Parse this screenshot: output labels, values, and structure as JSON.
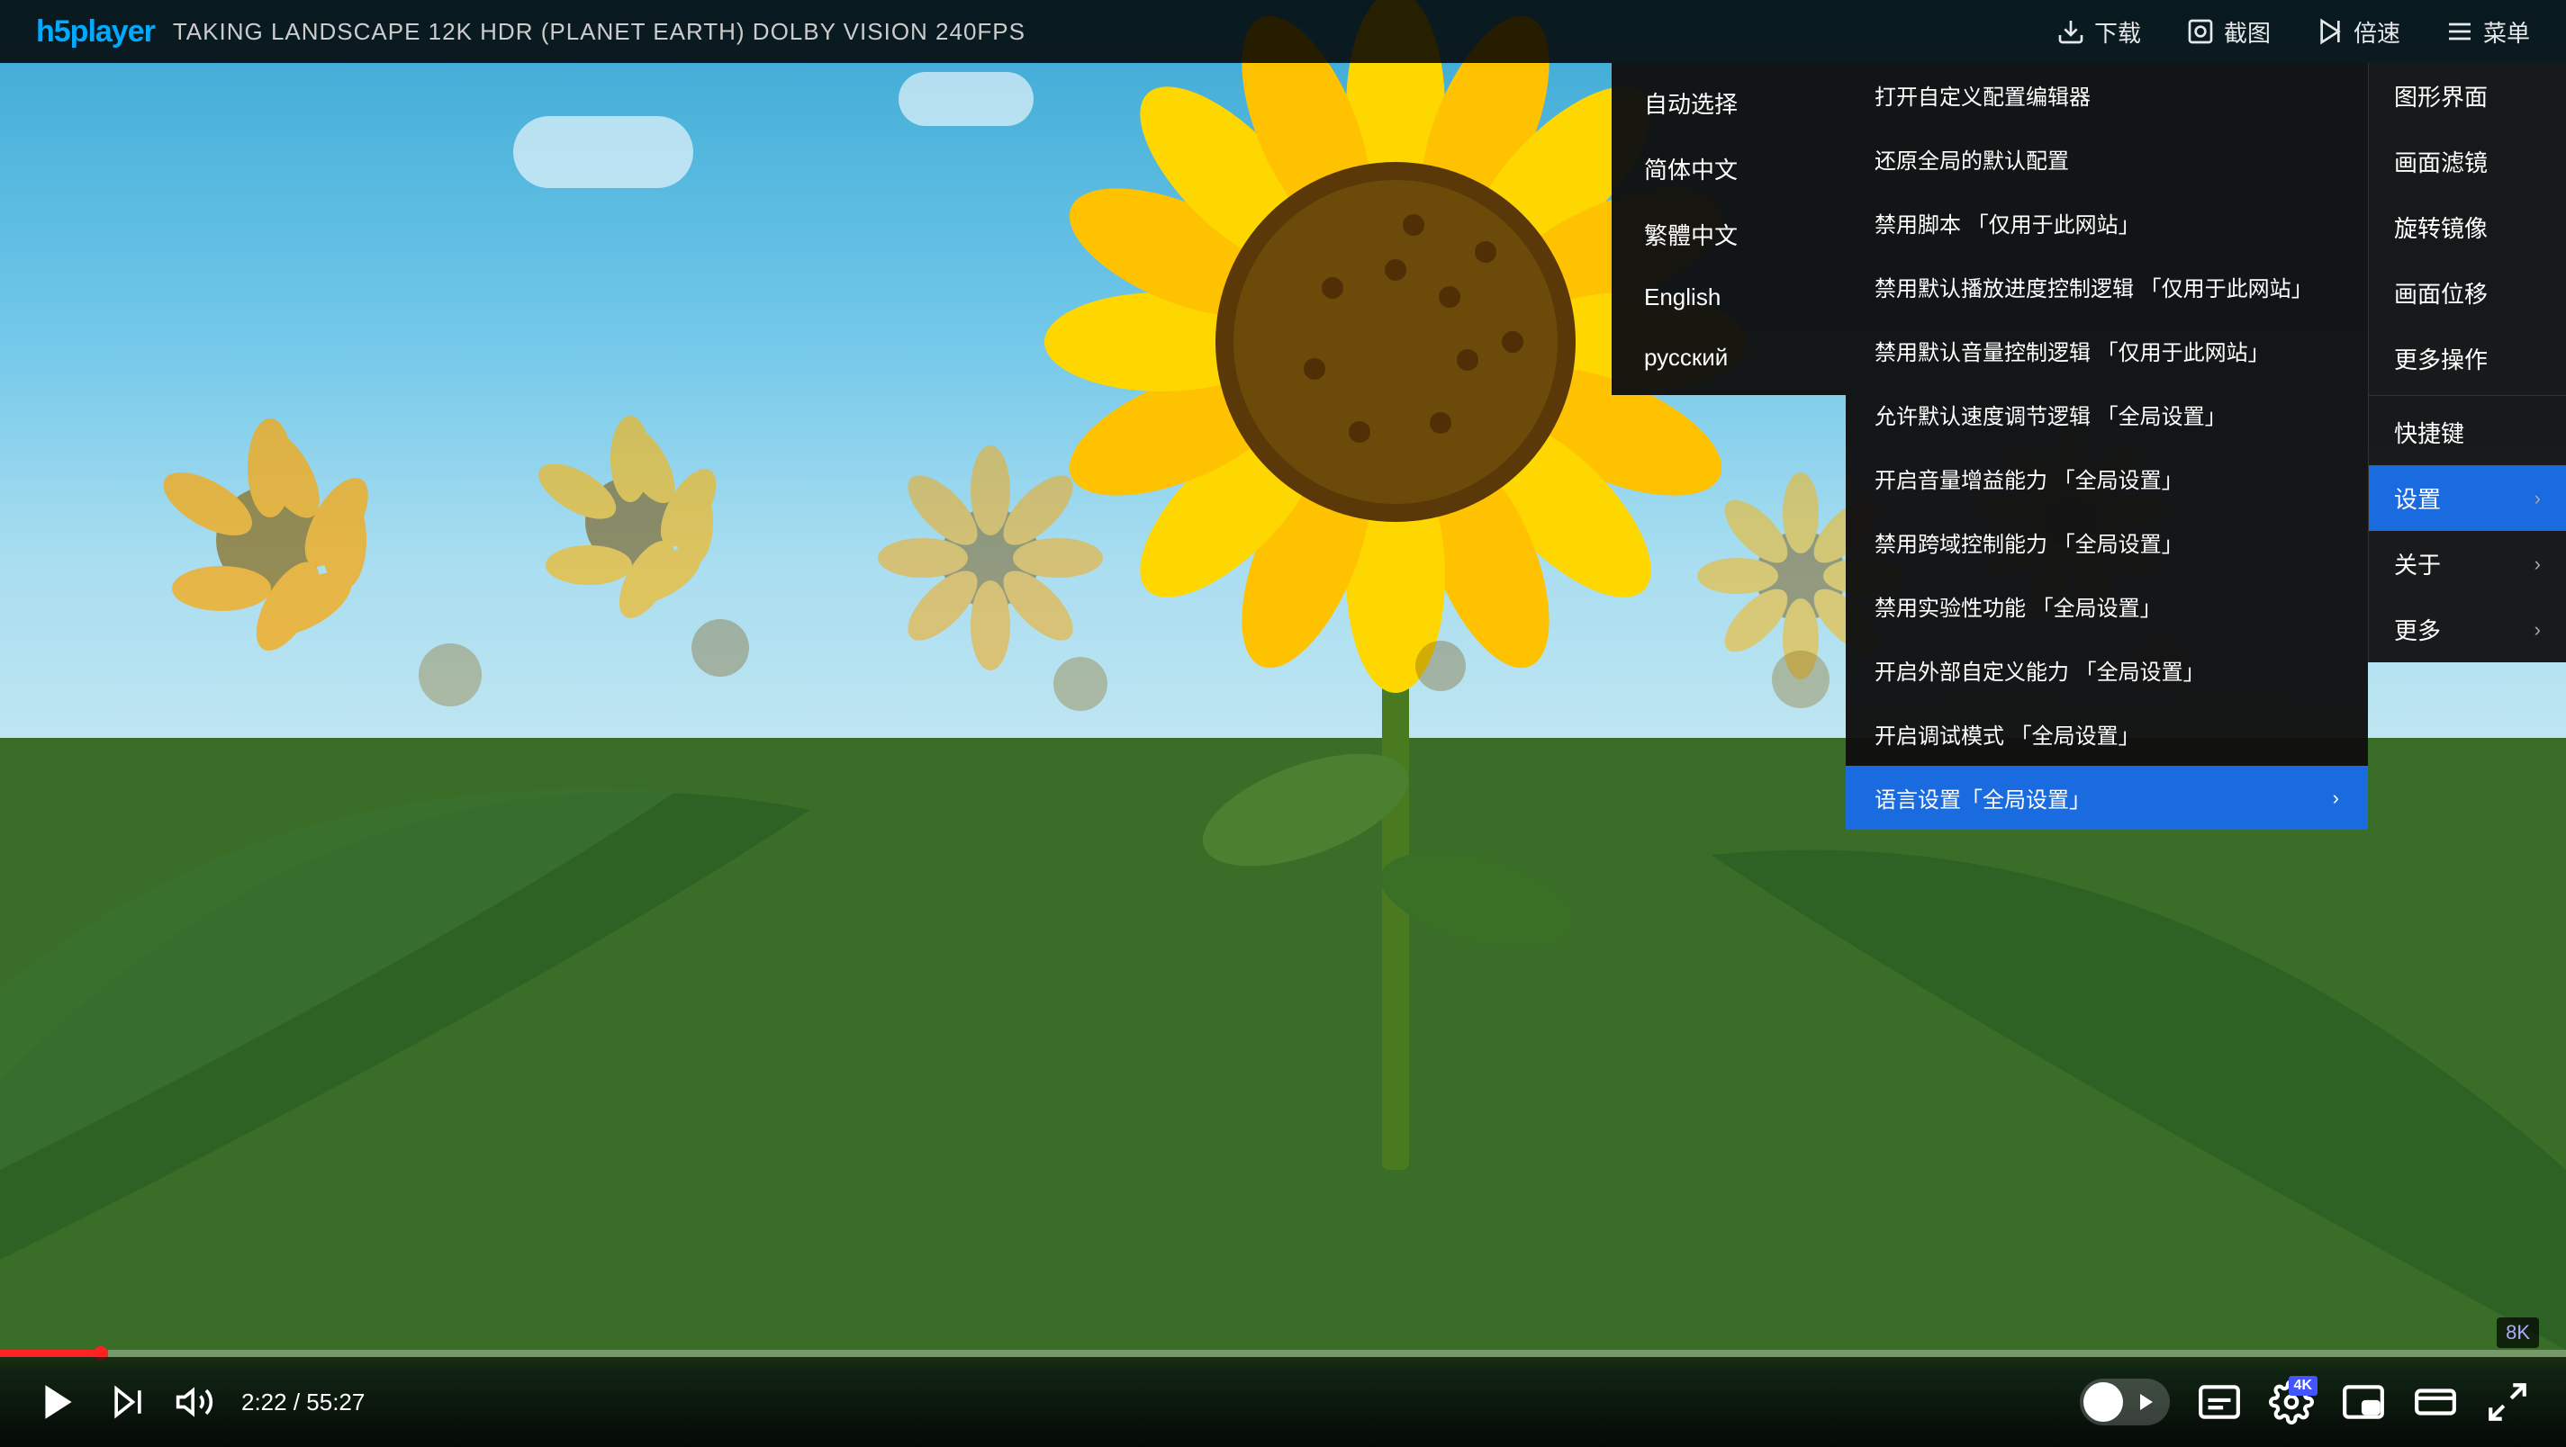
{
  "app": {
    "logo": "h5player",
    "video_title": "TAKING LANDSCAPE 12K HDR (PLANET EARTH) DOLBY VISION  240FPS"
  },
  "topbar": {
    "download_label": "下载",
    "screenshot_label": "截图",
    "speed_label": "倍速",
    "menu_label": "菜单"
  },
  "bottombar": {
    "time_current": "2:22",
    "time_total": "55:27"
  },
  "badge": "8K",
  "main_menu": {
    "items": [
      {
        "label": "图形界面",
        "has_arrow": false
      },
      {
        "label": "画面滤镜",
        "has_arrow": false
      },
      {
        "label": "旋转镜像",
        "has_arrow": false
      },
      {
        "label": "画面位移",
        "has_arrow": false
      },
      {
        "label": "更多操作",
        "has_arrow": false
      },
      {
        "divider": true
      },
      {
        "label": "快捷键",
        "has_arrow": false
      },
      {
        "label": "设置",
        "has_arrow": true,
        "highlighted": true
      },
      {
        "label": "关于",
        "has_arrow": true
      },
      {
        "label": "更多",
        "has_arrow": true
      }
    ]
  },
  "settings_submenu": {
    "items": [
      {
        "label": "打开自定义配置编辑器",
        "has_arrow": false
      },
      {
        "label": "还原全局的默认配置",
        "has_arrow": false
      },
      {
        "label": "禁用脚本 「仅用于此网站」",
        "has_arrow": false
      },
      {
        "label": "禁用默认播放进度控制逻辑 「仅用于此网站」",
        "has_arrow": false
      },
      {
        "label": "禁用默认音量控制逻辑 「仅用于此网站」",
        "has_arrow": false
      },
      {
        "label": "允许默认速度调节逻辑 「全局设置」",
        "has_arrow": false
      },
      {
        "label": "开启音量增益能力 「全局设置」",
        "has_arrow": false
      },
      {
        "label": "禁用跨域控制能力 「全局设置」",
        "has_arrow": false
      },
      {
        "label": "禁用实验性功能 「全局设置」",
        "has_arrow": false
      },
      {
        "label": "开启外部自定义能力 「全局设置」",
        "has_arrow": false
      },
      {
        "label": "开启调试模式 「全局设置」",
        "has_arrow": false
      },
      {
        "label": "语言设置「全局设置」",
        "has_arrow": true,
        "highlighted": true
      }
    ]
  },
  "language_submenu": {
    "items": [
      {
        "label": "自动选择",
        "active": false
      },
      {
        "label": "简体中文",
        "active": false
      },
      {
        "label": "繁體中文",
        "active": false
      },
      {
        "label": "English",
        "active": false
      },
      {
        "label": "русский",
        "active": false
      }
    ]
  }
}
